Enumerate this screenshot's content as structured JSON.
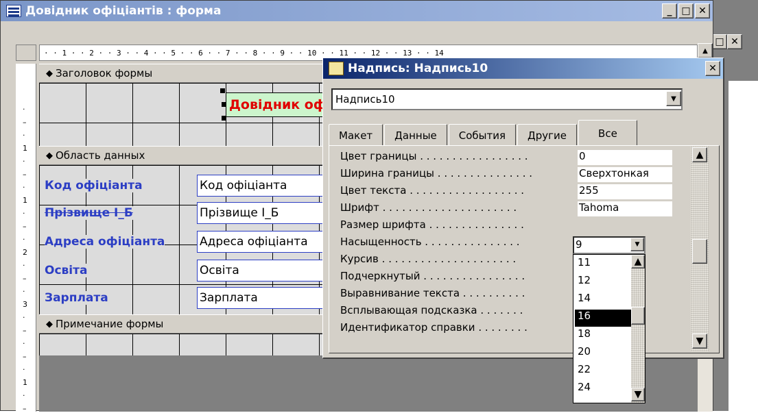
{
  "outer_window": {
    "restore_label": "□",
    "close_label": "✕"
  },
  "form_window": {
    "title": "Довідник офіціантів : форма",
    "minimize_label": "_",
    "maximize_label": "□",
    "close_label": "✕"
  },
  "ruler": {
    "horizontal_text": "· · 1 · · 2 · · 3 · · 4 · · 5 · · 6 · · 7 · · 8 · · 9 · · 10 · · 11 · · 12 · · 13 · · 14",
    "vertical_marks": [
      "·",
      "–",
      "·",
      "1",
      "·",
      "–",
      "·",
      "1",
      "·",
      "–",
      "·",
      "2",
      "·",
      "–",
      "·",
      "3",
      "·",
      "–",
      "·",
      "–",
      "·",
      "1",
      "·",
      "–"
    ]
  },
  "sections": {
    "header": "Заголовок формы",
    "detail": "Область данных",
    "footer": "Примечание формы"
  },
  "form_title_label": "Довідник оф",
  "fields": [
    {
      "label": "Код офіціанта",
      "value": "Код офіціанта"
    },
    {
      "label": "Прізвище І_Б",
      "value": "Прізвище І_Б"
    },
    {
      "label": "Адреса офіціанта",
      "value": "Адреса офіціанта"
    },
    {
      "label": "Освіта",
      "value": "Освіта"
    },
    {
      "label": "Зарплата",
      "value": "Зарплата"
    }
  ],
  "properties_dialog": {
    "title": "Надпись: Надпись10",
    "close_label": "✕",
    "object_combo": "Надпись10",
    "tabs": [
      "Макет",
      "Данные",
      "События",
      "Другие",
      "Все"
    ],
    "active_tab": "Все",
    "rows": [
      {
        "name": "Цвет границы . . . . . . . . . . . . . . . . .",
        "value": "0"
      },
      {
        "name": "Ширина границы . . . . . . . . . . . . . . .",
        "value": "Сверхтонкая"
      },
      {
        "name": "Цвет текста . . . . . . . . . . . . . . . . . .",
        "value": "255"
      },
      {
        "name": "Шрифт . . . . . . . . . . . . . . . . . . . . .",
        "value": "Tahoma"
      },
      {
        "name": "Размер шрифта . . . . . . . . . . . . . . .",
        "value": ""
      },
      {
        "name": "Насыщенность . . . . . . . . . . . . . . .",
        "value": ""
      },
      {
        "name": "Курсив . . . . . . . . . . . . . . . . . . . . .",
        "value": ""
      },
      {
        "name": "Подчеркнутый . . . . . . . . . . . . . . . .",
        "value": ""
      },
      {
        "name": "Выравнивание текста . . . . . . . . . .",
        "value": ""
      },
      {
        "name": "Всплывающая подсказка . . . . . . .",
        "value": ""
      },
      {
        "name": "Идентификатор справки . . . . . . . .",
        "value": ""
      }
    ],
    "font_size_value": "9",
    "font_size_options": [
      "11",
      "12",
      "14",
      "16",
      "18",
      "20",
      "22",
      "24"
    ],
    "font_size_selected": "16"
  },
  "colors": {
    "label_blue": "#2c3ec4",
    "title_red": "#e00000",
    "title_bg": "#ccf5cc",
    "dialog_title": "#0a246a"
  },
  "icons": {
    "form_icon": "form-icon",
    "props_icon": "properties-icon",
    "section_arrow": "section-arrow-icon",
    "scroll_up": "▲",
    "scroll_down": "▼"
  }
}
